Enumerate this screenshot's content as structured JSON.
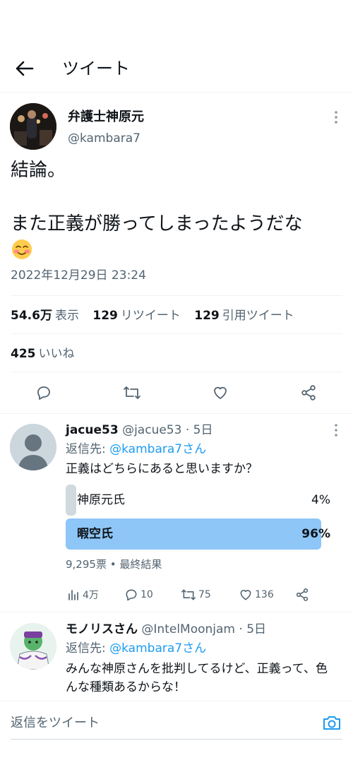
{
  "header": {
    "title": "ツイート"
  },
  "tweet": {
    "author_name": "弁護士神原元",
    "author_handle": "@kambara7",
    "text": "結論。\n\nまた正義が勝ってしまったようだな",
    "timestamp": "2022年12月29日 23:24",
    "stats": {
      "views_count": "54.6万",
      "views_label": "表示",
      "retweets_count": "129",
      "retweets_label": "リツイート",
      "quotes_count": "129",
      "quotes_label": "引用ツイート",
      "likes_count": "425",
      "likes_label": "いいね"
    }
  },
  "replies": [
    {
      "name": "jacue53",
      "handle": "@jacue53",
      "time": "· 5日",
      "reply_to_prefix": "返信先: ",
      "reply_to": "@kambara7さん",
      "text": "正義はどちらにあると思いますか？",
      "poll": {
        "options": [
          {
            "label": "神原元氏",
            "percent": "4%",
            "value": 4,
            "winner": false
          },
          {
            "label": "暇空氏",
            "percent": "96%",
            "value": 96,
            "winner": true
          }
        ],
        "summary": "9,295票 • 最終結果"
      },
      "actions": {
        "views": "4万",
        "replies": "10",
        "retweets": "75",
        "likes": "136"
      }
    },
    {
      "name": "モノリスさん",
      "handle": "@IntelMoonjam",
      "time": "· 5日",
      "reply_to_prefix": "返信先: ",
      "reply_to": "@kambara7さん",
      "text": "みんな神原さんを批判してるけど、正義って、色んな種類あるからな！"
    }
  ],
  "composer": {
    "placeholder": "返信をツイート"
  },
  "colors": {
    "accent": "#1d9bf0",
    "poll_winner": "#8ec6f7",
    "poll_loser": "#cfd9de",
    "muted": "#536471"
  }
}
